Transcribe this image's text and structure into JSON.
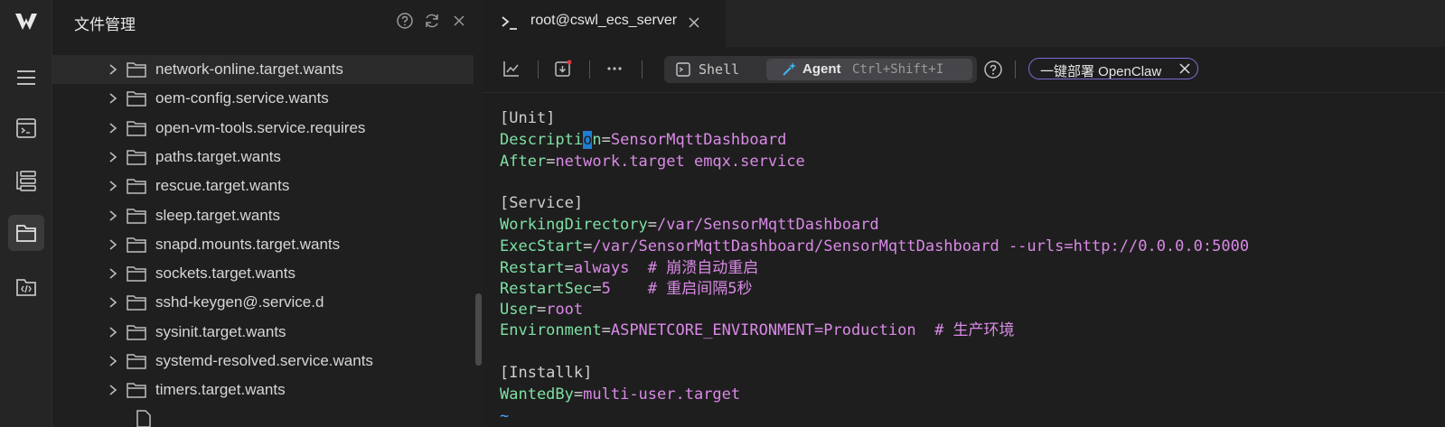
{
  "file_panel": {
    "title": "文件管理",
    "items": [
      {
        "label": "network-online.target.wants"
      },
      {
        "label": "oem-config.service.wants"
      },
      {
        "label": "open-vm-tools.service.requires"
      },
      {
        "label": "paths.target.wants"
      },
      {
        "label": "rescue.target.wants"
      },
      {
        "label": "sleep.target.wants"
      },
      {
        "label": "snapd.mounts.target.wants"
      },
      {
        "label": "sockets.target.wants"
      },
      {
        "label": "sshd-keygen@.service.d"
      },
      {
        "label": "sysinit.target.wants"
      },
      {
        "label": "systemd-resolved.service.wants"
      },
      {
        "label": "timers.target.wants"
      }
    ]
  },
  "tab": {
    "label": "root@cswl_ecs_server"
  },
  "toolbar": {
    "shell_label": "Shell",
    "agent_label": "Agent",
    "agent_shortcut": "Ctrl+Shift+I",
    "deploy_label": "一键部署 OpenClaw"
  },
  "terminal": {
    "unit_header": "[Unit]",
    "desc_key_a": "Descripti",
    "desc_key_cursor": "o",
    "desc_key_b": "n",
    "desc_value": "SensorMqttDashboard",
    "after_key": "After",
    "after_value": "network.target emqx.service",
    "service_header": "[Service]",
    "wd_key": "WorkingDirectory",
    "wd_value": "/var/SensorMqttDashboard",
    "exec_key": "ExecStart",
    "exec_value": "/var/SensorMqttDashboard/SensorMqttDashboard --urls=http://0.0.0.0:5000",
    "restart_key": "Restart",
    "restart_value": "always  # 崩溃自动重启",
    "restartsec_key": "RestartSec",
    "restartsec_value": "5    # 重启间隔5秒",
    "user_key": "User",
    "user_value": "root",
    "env_key": "Environment",
    "env_value": "ASPNETCORE_ENVIRONMENT=Production  # 生产环境",
    "install_header": "[Installk]",
    "wanted_key": "WantedBy",
    "wanted_value": "multi-user.target",
    "tilde": "~",
    "equals": "="
  },
  "colors": {
    "key": "#7ee0a4",
    "value": "#d98ae6",
    "cursor": "#1e7fd3",
    "accent": "#7b6dd8"
  }
}
